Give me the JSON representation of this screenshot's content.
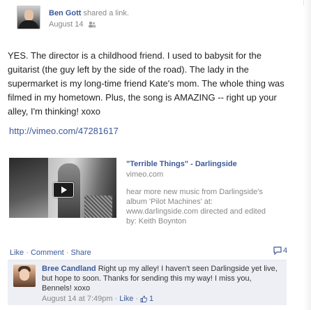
{
  "post": {
    "author": "Ben Gott",
    "action": " shared a link.",
    "date": "August 14",
    "message": "YES. The director is a childhood friend. I used to babysit for the guitarist (the guy left by the side of the road). The lady in the supermarket is my long-time friend Kate's mom. The whole thing was filmed in my hometown. Plus, the song is AMAZING -- right up your alley, I'm thinking! xoxo",
    "link": "http://vimeo.com/47281617"
  },
  "attachment": {
    "title": "\"Terrible Things\" - Darlingside",
    "domain": "vimeo.com",
    "description": "hear more new music from Darlingside's album 'Pilot Machines' at: www.darlingside.com directed and edited by: Keith Boynton"
  },
  "actions": {
    "like": "Like",
    "sep1": " · ",
    "comment": "Comment",
    "sep2": " · ",
    "share": "Share",
    "comment_count": "4"
  },
  "comment": {
    "author": "Bree Candland",
    "text": " Right up my alley! I haven't seen Darlingside yet live, but hope to soon. Thanks for sending this my way! I miss you, Bennels! xoxo",
    "time": "August 14 at 7:49pm",
    "sep": " · ",
    "like": "Like",
    "sep2": " · ",
    "likes": "1"
  },
  "colors": {
    "link": "#3b5998",
    "muted": "#888888",
    "comment_bg": "#edeff4"
  },
  "icons": {
    "play": "play-icon",
    "audience": "people-icon",
    "comments": "speech-bubble-icon",
    "likes": "thumbs-up-icon"
  }
}
